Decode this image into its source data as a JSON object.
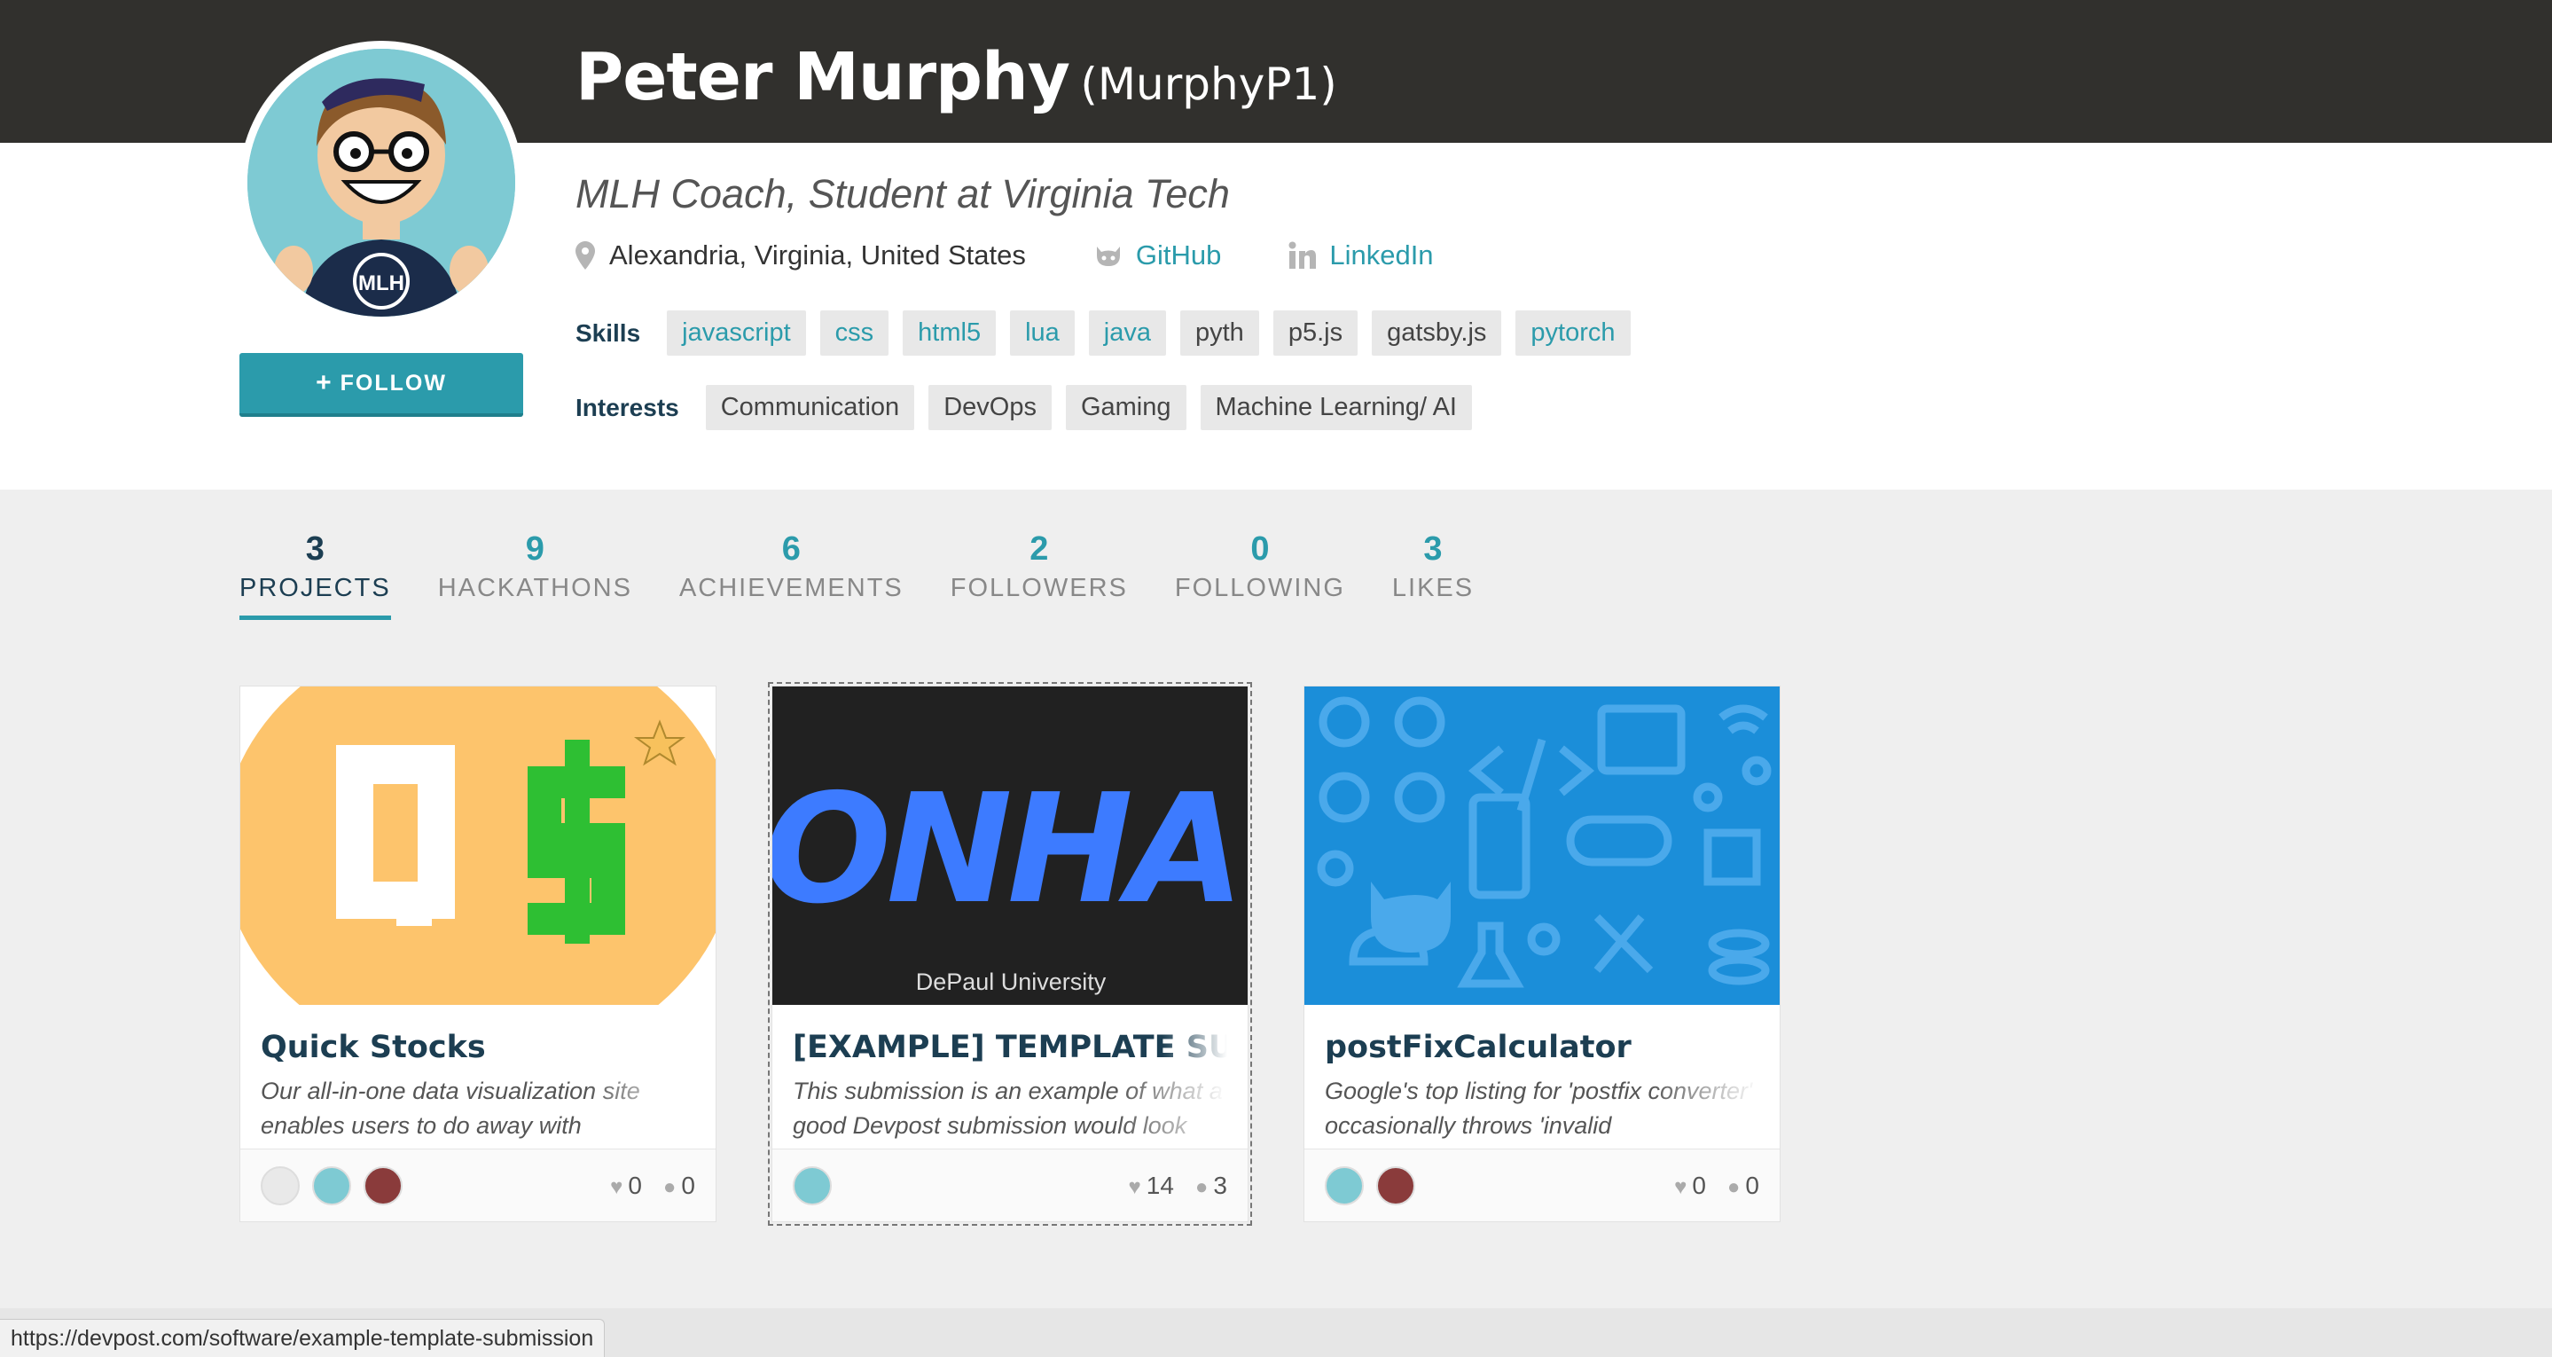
{
  "profile": {
    "name": "Peter Murphy",
    "username": "(MurphyP1)",
    "tagline": "MLH Coach, Student at Virginia Tech",
    "location": "Alexandria, Virginia, United States",
    "github_label": "GitHub",
    "linkedin_label": "LinkedIn",
    "follow_label": "FOLLOW",
    "follow_icon": "plus-icon"
  },
  "skills": {
    "label": "Skills",
    "items": [
      "javascript",
      "css",
      "html5",
      "lua",
      "java",
      "pyth",
      "p5.js",
      "gatsby.js",
      "pytorch"
    ]
  },
  "interests": {
    "label": "Interests",
    "items": [
      "Communication",
      "DevOps",
      "Gaming",
      "Machine Learning/ AI"
    ]
  },
  "stats": [
    {
      "num": "3",
      "label": "PROJECTS"
    },
    {
      "num": "9",
      "label": "HACKATHONS"
    },
    {
      "num": "6",
      "label": "ACHIEVEMENTS"
    },
    {
      "num": "2",
      "label": "FOLLOWERS"
    },
    {
      "num": "0",
      "label": "FOLLOWING"
    },
    {
      "num": "3",
      "label": "LIKES"
    }
  ],
  "projects": [
    {
      "title": "Quick Stocks",
      "desc": "Our all-in-one data visualization site enables users to do away with",
      "likes": "0",
      "comments": "0"
    },
    {
      "title": "[EXAMPLE] TEMPLATE SUBMISSION",
      "desc": "This submission is an example of what a good Devpost submission would look",
      "likes": "14",
      "comments": "3",
      "thumb_text": "ONHA",
      "thumb_caption": "DePaul University"
    },
    {
      "title": "postFixCalculator",
      "desc": "Google's top listing for 'postfix converter' occasionally throws 'invalid",
      "likes": "0",
      "comments": "0"
    }
  ],
  "status_url": "https://devpost.com/software/example-template-submission",
  "colors": {
    "accent": "#2b9bab",
    "dark": "#31302d",
    "navy": "#1c3e52"
  }
}
